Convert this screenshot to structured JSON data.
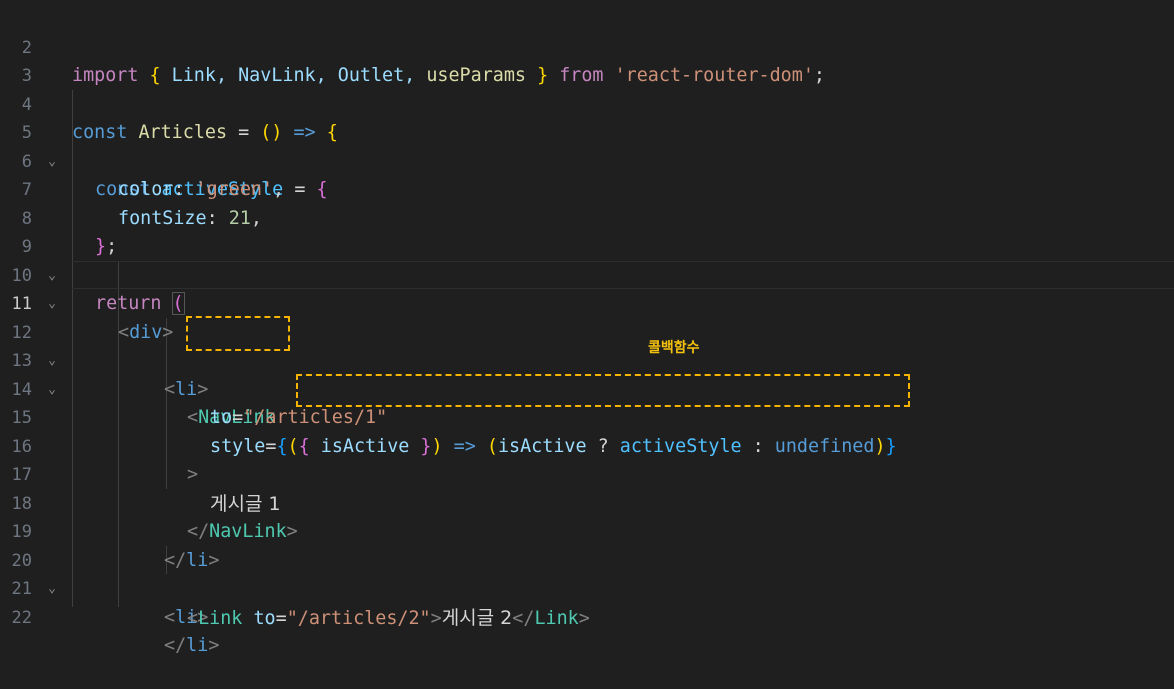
{
  "editor": {
    "language": "javascript",
    "active_line": "11",
    "annotation": "콜백함수"
  },
  "lines": [
    {
      "num": "2",
      "foldable": false
    },
    {
      "num": "3",
      "foldable": false
    },
    {
      "num": "4",
      "foldable": false
    },
    {
      "num": "5",
      "foldable": true
    },
    {
      "num": "6",
      "foldable": false
    },
    {
      "num": "7",
      "foldable": false
    },
    {
      "num": "8",
      "foldable": false
    },
    {
      "num": "9",
      "foldable": true
    },
    {
      "num": "10",
      "foldable": true
    },
    {
      "num": "11",
      "foldable": false
    },
    {
      "num": "12",
      "foldable": true
    },
    {
      "num": "13",
      "foldable": true
    },
    {
      "num": "14",
      "foldable": false
    },
    {
      "num": "15",
      "foldable": false
    },
    {
      "num": "16",
      "foldable": false
    },
    {
      "num": "17",
      "foldable": false
    },
    {
      "num": "18",
      "foldable": false
    },
    {
      "num": "19",
      "foldable": false
    },
    {
      "num": "20",
      "foldable": true
    },
    {
      "num": "21",
      "foldable": false
    },
    {
      "num": "22",
      "foldable": false
    }
  ],
  "code": {
    "l2": {
      "import": "import",
      "ob": "{",
      "ids": " Link, NavLink, Outlet, ",
      "useParams": "useParams",
      "cb": "}",
      "from": "from",
      "str": "'react-router-dom'",
      "semi": ";"
    },
    "l4": {
      "const": "const",
      "name": "Articles",
      "eq": " = ",
      "open": "(",
      "close": ")",
      "arrow": "=>",
      "brace": "{"
    },
    "l5": {
      "const": "const",
      "name": "activeStyle",
      "eq": " = ",
      "brace": "{"
    },
    "l6": {
      "key": "color",
      "colon": ": ",
      "val": "'green'",
      "comma": ","
    },
    "l7": {
      "key": "fontSize",
      "colon": ": ",
      "val": "21",
      "comma": ","
    },
    "l8": {
      "brace": "}",
      "semi": ";"
    },
    "l9": {
      "return": "return",
      "paren": "("
    },
    "l10": {
      "lt": "<",
      "tag": "div",
      "gt": ">"
    },
    "l12": {
      "lt": "<",
      "tag": "li",
      "gt": ">"
    },
    "l13": {
      "lt": "<",
      "tag": "NavLink"
    },
    "l14": {
      "attr": "to",
      "eq": "=",
      "val": "\"/articles/1\""
    },
    "l15": {
      "attr": "style",
      "eq": "=",
      "ob": "{",
      "p1": "(",
      "ob2": "{",
      "arg": " isActive ",
      "cb2": "}",
      "p2": ")",
      "arrow": "=>",
      "p3": "(",
      "cond": "isActive",
      "q": " ? ",
      "a": "activeStyle",
      "colon": " : ",
      "b": "undefined",
      "p4": ")",
      "cb": "}"
    },
    "l16": {
      "gt": ">"
    },
    "l17": {
      "text": "게시글 1"
    },
    "l18": {
      "lt": "</",
      "tag": "NavLink",
      "gt": ">"
    },
    "l19": {
      "lt": "</",
      "tag": "li",
      "gt": ">"
    },
    "l20": {
      "lt": "<",
      "tag": "li",
      "gt": ">"
    },
    "l21": {
      "lt": "<",
      "tag": "Link",
      "attr": "to",
      "eq": "=",
      "val": "\"/articles/2\"",
      "gt": ">",
      "text": "게시글 2",
      "lt2": "</",
      "tag2": "Link",
      "gt2": ">"
    },
    "l22": {
      "lt": "</",
      "tag": "li",
      "gt": ">"
    }
  },
  "colors": {
    "background": "#1f1f1f",
    "highlight_box": "#f4b400",
    "annotation_text": "#f4c20d"
  }
}
